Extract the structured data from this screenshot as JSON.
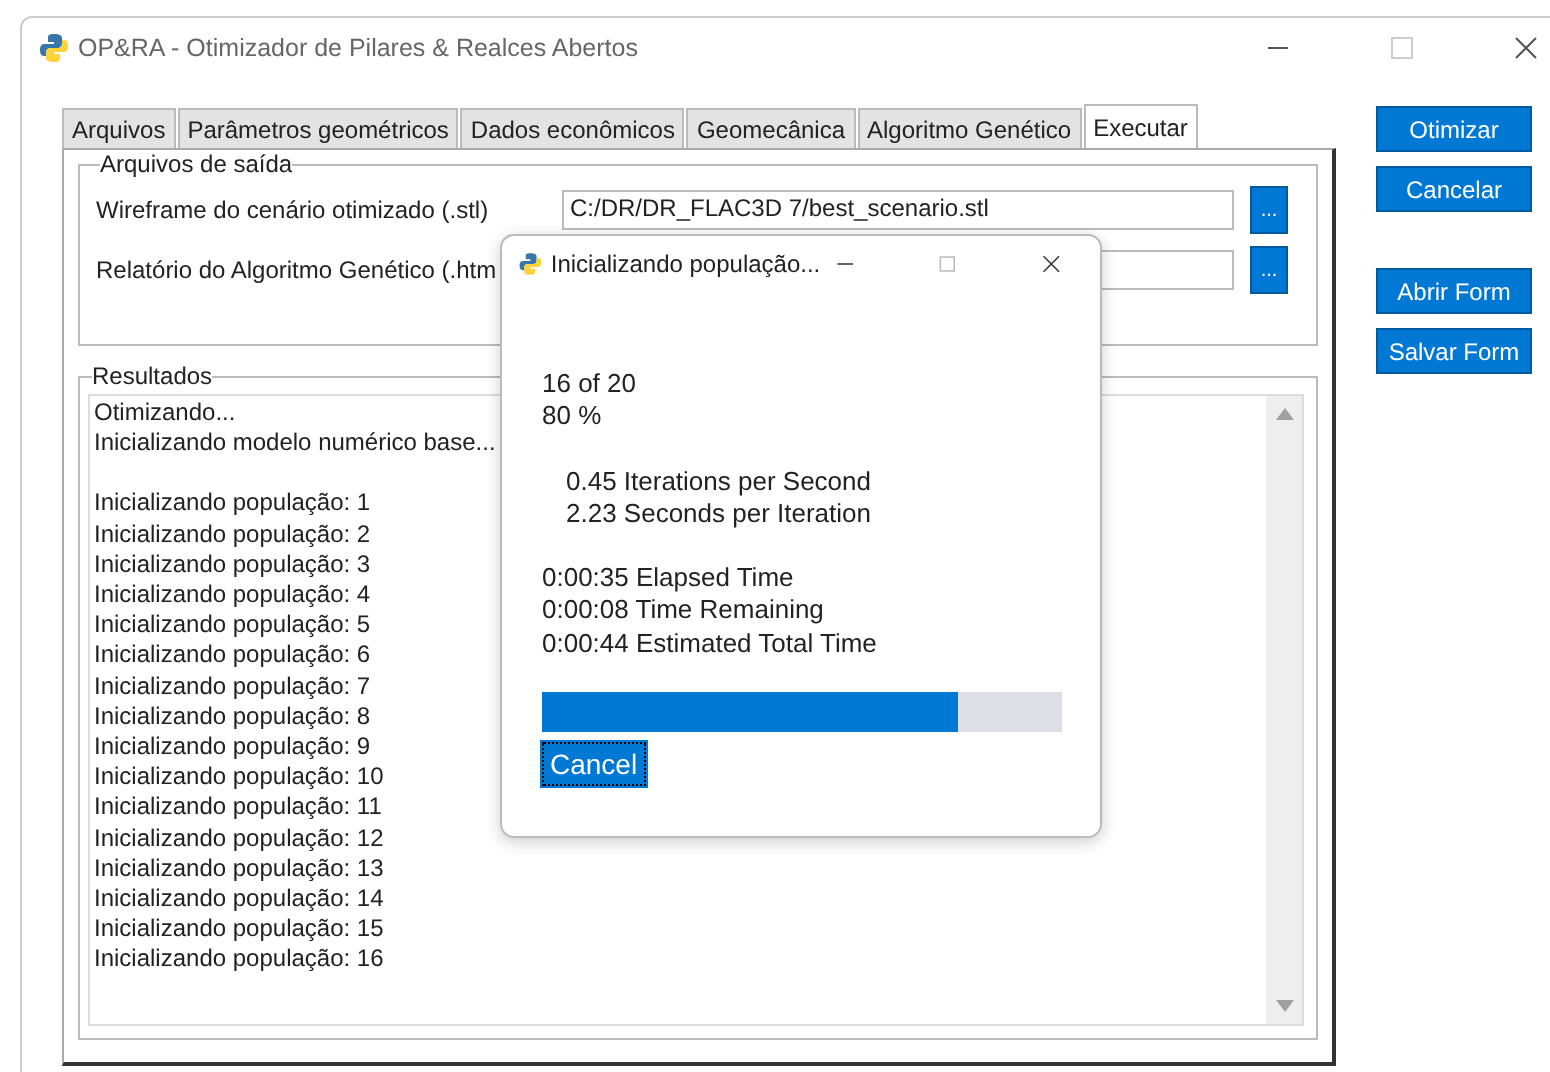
{
  "window": {
    "title": "OP&RA - Otimizador de Pilares & Realces Abertos"
  },
  "tabs": [
    {
      "label": "Arquivos",
      "selected": false
    },
    {
      "label": "Parâmetros geométricos",
      "selected": false
    },
    {
      "label": "Dados econômicos",
      "selected": false
    },
    {
      "label": "Geomecânica",
      "selected": false
    },
    {
      "label": "Algoritmo Genético",
      "selected": false
    },
    {
      "label": "Executar",
      "selected": true
    }
  ],
  "output_files": {
    "title": "Arquivos de saída",
    "fields": [
      {
        "label": "Wireframe do cenário otimizado (.stl)",
        "value": "C:/DR/DR_FLAC3D 7/best_scenario.stl",
        "button": "..."
      },
      {
        "label": "Relatório do Algoritmo Genético (.htm",
        "button": "..."
      }
    ]
  },
  "results": {
    "title": "Resultados",
    "paragraphs": [
      [
        "Otimizando...",
        "Inicializando modelo numérico base..."
      ],
      [
        "Inicializando população: 1",
        "Inicializando população: 2",
        "Inicializando população: 3",
        "Inicializando população: 4",
        "Inicializando população: 5",
        "Inicializando população: 6",
        "Inicializando população: 7",
        "Inicializando população: 8",
        "Inicializando população: 9",
        "Inicializando população: 10",
        "Inicializando população: 11",
        "Inicializando população: 12",
        "Inicializando população: 13",
        "Inicializando população: 14",
        "Inicializando população: 15",
        "Inicializando população: 16"
      ]
    ]
  },
  "side_button_groups": [
    [
      "Otimizar",
      "Cancelar"
    ],
    [
      "Abrir Form",
      "Salvar Form"
    ]
  ],
  "dialog": {
    "title": "Inicializando população...",
    "count": [
      "16 of 20",
      "80 %"
    ],
    "rates": [
      "0.45 Iterations per Second",
      "2.23 Seconds per Iteration"
    ],
    "times": [
      "0:00:35 Elapsed Time",
      "0:00:08 Time Remaining",
      "0:00:44 Estimated Total Time"
    ],
    "progress": {
      "level": 0.8
    },
    "button": "Cancel"
  }
}
